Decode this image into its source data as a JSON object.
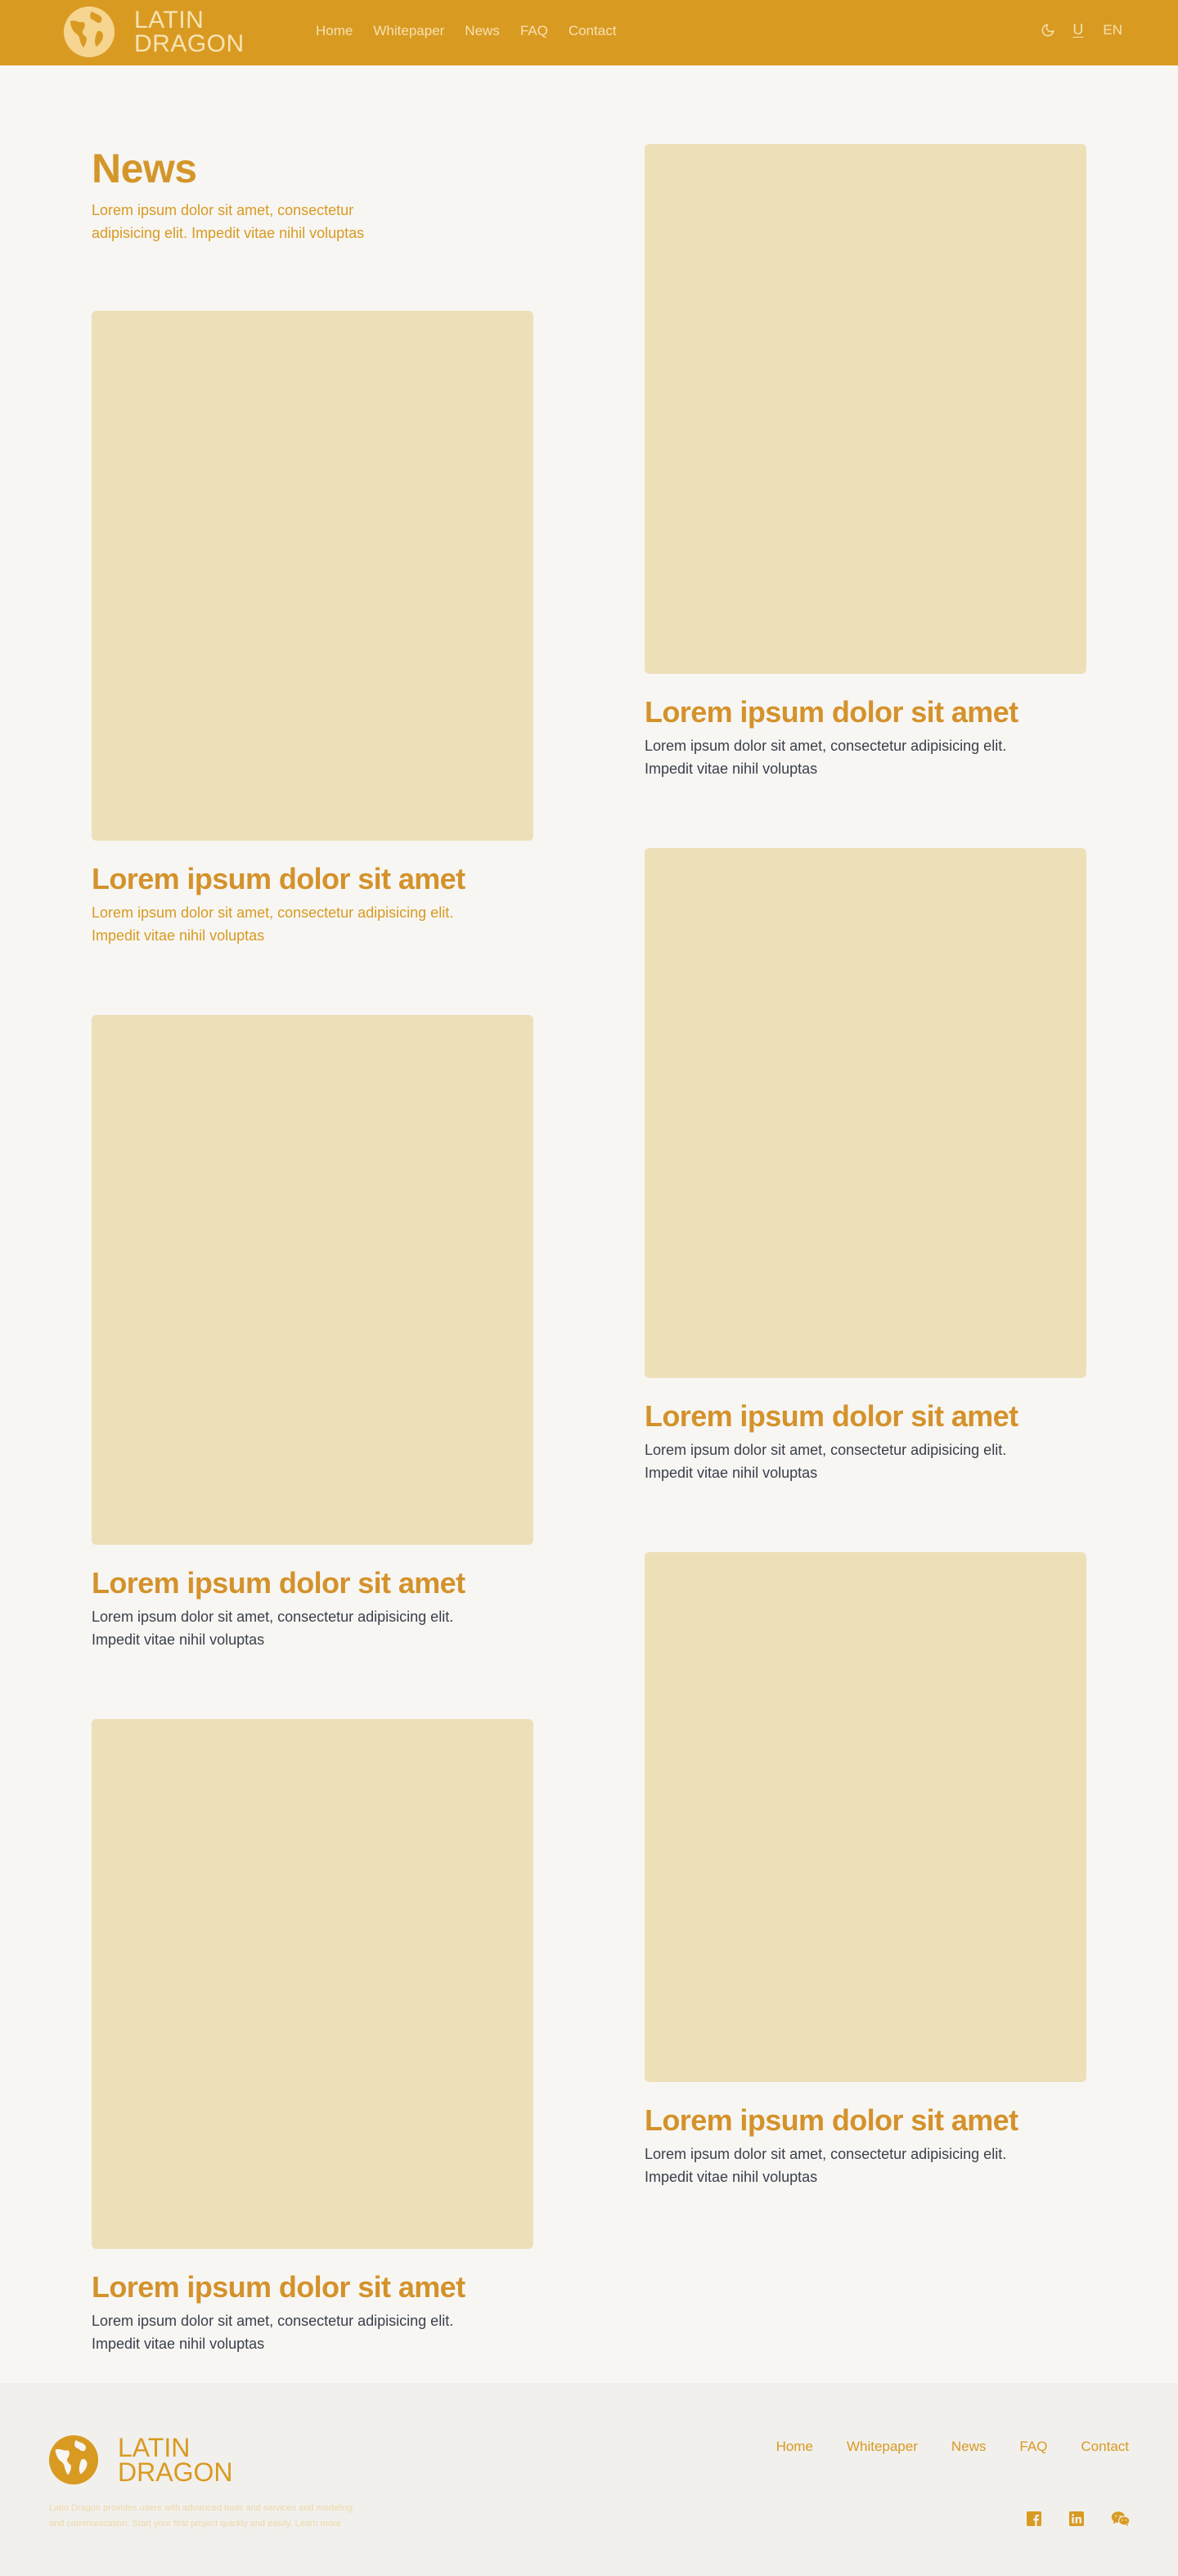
{
  "header": {
    "logo": {
      "line1": "LATIN",
      "line2": "DRAGON"
    },
    "nav": [
      "Home",
      "Whitepaper",
      "News",
      "FAQ",
      "Contact"
    ],
    "tools": {
      "theme_icon": "moon-icon",
      "underline_label": "U",
      "language": "EN"
    }
  },
  "intro": {
    "title": "News",
    "description": "Lorem ipsum dolor sit amet, consectetur adipisicing elit. Impedit vitae nihil voluptas"
  },
  "articles": [
    {
      "title": "Lorem ipsum dolor sit amet",
      "description": "Lorem ipsum dolor sit amet, consectetur adipisicing elit. Impedit vitae nihil voluptas"
    },
    {
      "title": "Lorem ipsum dolor sit amet",
      "description": "Lorem ipsum dolor sit amet, consectetur adipisicing elit. Impedit vitae nihil voluptas"
    },
    {
      "title": "Lorem ipsum dolor sit amet",
      "description": "Lorem ipsum dolor sit amet, consectetur adipisicing elit. Impedit vitae nihil voluptas"
    },
    {
      "title": "Lorem ipsum dolor sit amet",
      "description": "Lorem ipsum dolor sit amet, consectetur adipisicing elit. Impedit vitae nihil voluptas"
    },
    {
      "title": "Lorem ipsum dolor sit amet",
      "description": "Lorem ipsum dolor sit amet, consectetur adipisicing elit. Impedit vitae nihil voluptas"
    },
    {
      "title": "Lorem ipsum dolor sit amet",
      "description": "Lorem ipsum dolor sit amet, consectetur adipisicing elit. Impedit vitae nihil voluptas"
    }
  ],
  "footer": {
    "logo": {
      "line1": "LATIN",
      "line2": "DRAGON"
    },
    "description": "Latin Dragon provides users with advanced tools and services and modeling and communication. Start your first project quickly and easily. Learn more",
    "nav": [
      "Home",
      "Whitepaper",
      "News",
      "FAQ",
      "Contact"
    ],
    "social": [
      "facebook-icon",
      "linkedin-icon",
      "wechat-icon"
    ]
  },
  "colors": {
    "brand": "#d99a22",
    "background": "#f7f6f3",
    "placeholder": "#ede0b8",
    "footer_bg": "#f1f0ec",
    "text": "#3a3f4b"
  }
}
